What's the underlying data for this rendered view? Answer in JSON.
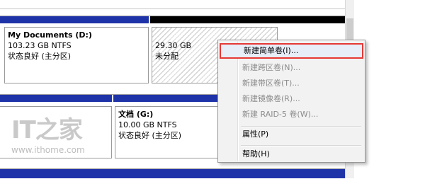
{
  "volumes": {
    "my_documents": {
      "title": "My Documents  (D:)",
      "size": "103.23 GB NTFS",
      "status": "状态良好 (主分区)"
    },
    "unallocated": {
      "size": "29.30 GB",
      "status": "未分配"
    },
    "wendang": {
      "title": "文档  (G:)",
      "size": "10.00 GB NTFS",
      "status": "状态良好 (主分区)"
    }
  },
  "watermark": {
    "logo": "IT之家",
    "url": "www.ithome.com"
  },
  "context_menu": {
    "items": [
      {
        "label": "新建简单卷(I)...",
        "enabled": true,
        "highlighted": true
      },
      {
        "label": "新建跨区卷(N)...",
        "enabled": false
      },
      {
        "label": "新建带区卷(T)...",
        "enabled": false
      },
      {
        "label": "新建镜像卷(R)...",
        "enabled": false
      },
      {
        "label": "新建 RAID-5 卷(W)...",
        "enabled": false
      },
      {
        "label": "属性(P)",
        "enabled": true
      },
      {
        "label": "帮助(H)",
        "enabled": true
      }
    ]
  },
  "colors": {
    "primary_bar": "#1f33a8",
    "unallocated_bar": "#000000",
    "highlight_border": "#e53935"
  }
}
